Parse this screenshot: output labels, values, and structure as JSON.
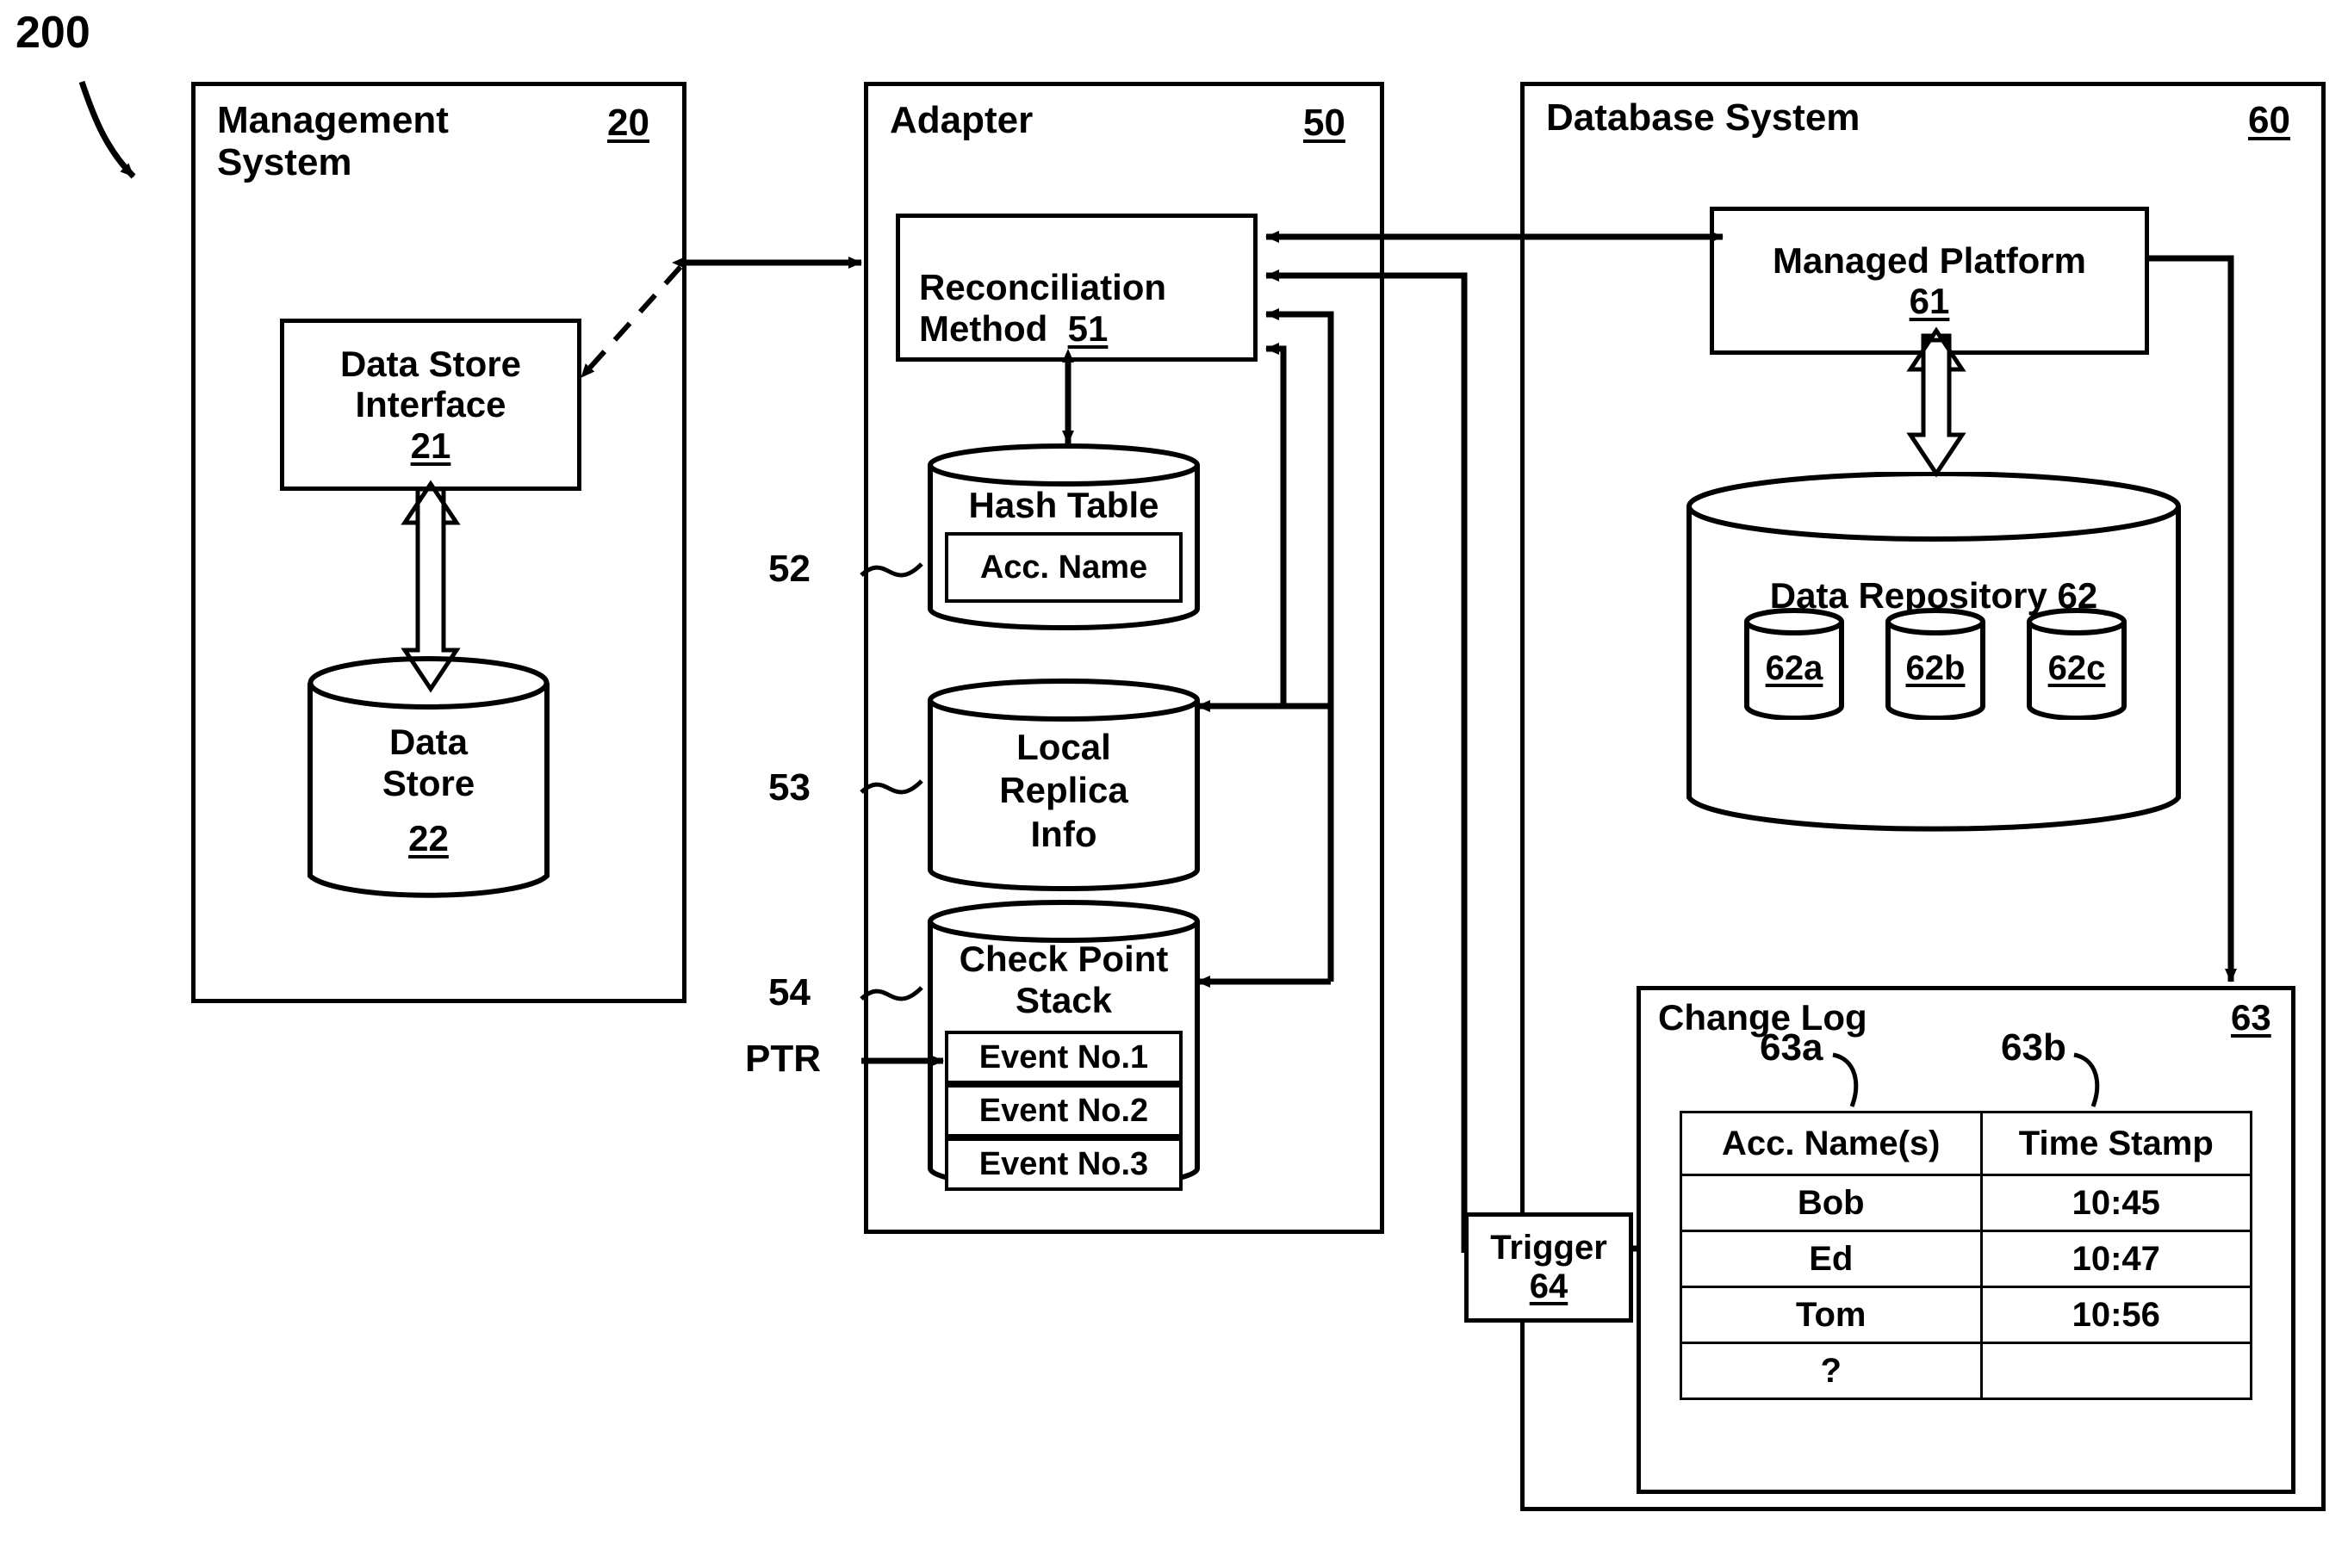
{
  "figure": {
    "ref_label": "200"
  },
  "management_system": {
    "title": "Management\nSystem",
    "number": "20",
    "data_store_interface": {
      "label": "Data Store\nInterface",
      "number": "21"
    },
    "data_store": {
      "label": "Data\nStore",
      "number": "22"
    }
  },
  "adapter": {
    "title": "Adapter",
    "number": "50",
    "reconciliation_method": {
      "label": "Reconciliation\nMethod",
      "number": "51"
    },
    "hash_table": {
      "label": "Hash Table",
      "number": "52",
      "slot": "Acc. Name"
    },
    "local_replica_info": {
      "label": "Local\nReplica\nInfo",
      "number": "53"
    },
    "check_point_stack": {
      "label": "Check Point\nStack",
      "number": "54",
      "pointer_label": "PTR",
      "events": [
        "Event No.1",
        "Event No.2",
        "Event No.3"
      ]
    }
  },
  "database_system": {
    "title": "Database System",
    "number": "60",
    "managed_platform": {
      "label": "Managed Platform",
      "number": "61"
    },
    "data_repository": {
      "label": "Data Repository",
      "number": "62",
      "stores": [
        "62a",
        "62b",
        "62c"
      ]
    },
    "change_log": {
      "title": "Change Log",
      "number": "63",
      "column_refs": [
        "63a",
        "63b"
      ],
      "columns": [
        "Acc. Name(s)",
        "Time Stamp"
      ],
      "rows": [
        [
          "Bob",
          "10:45"
        ],
        [
          "Ed",
          "10:47"
        ],
        [
          "Tom",
          "10:56"
        ],
        [
          "?",
          ""
        ]
      ]
    },
    "trigger": {
      "label": "Trigger",
      "number": "64"
    }
  },
  "style": {
    "ink": "#000000",
    "paper": "#ffffff"
  }
}
